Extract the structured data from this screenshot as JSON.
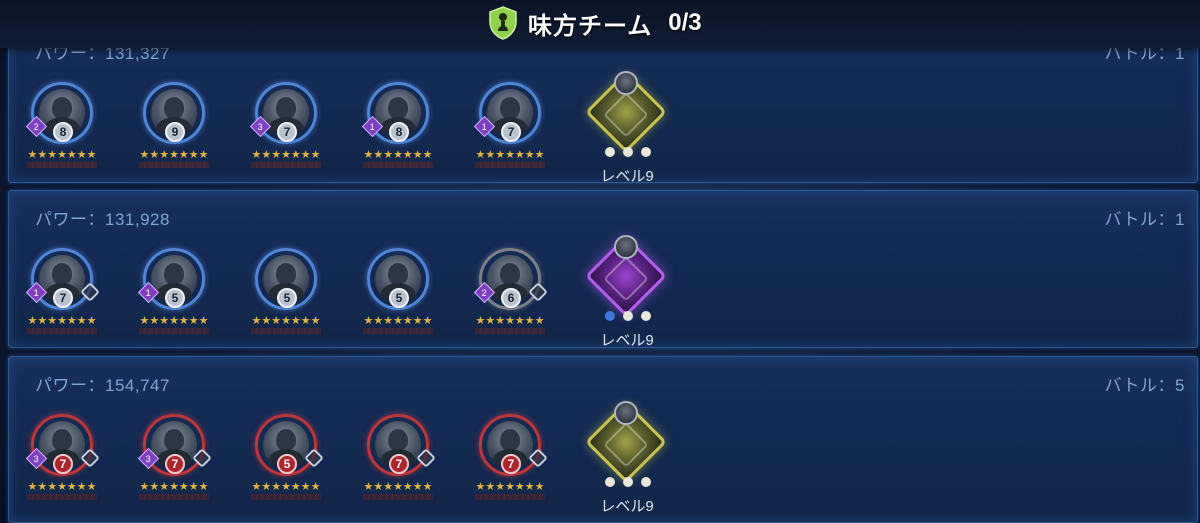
{
  "header": {
    "title": "味方チーム",
    "count": "0/3",
    "icon": "shield-person-icon",
    "icon_color": "#8fd24a"
  },
  "teams": [
    {
      "power": "パワー：131,327",
      "battle": "バトル：1",
      "characters": [
        {
          "gear": "8",
          "relic_color": "blue",
          "zeta": "2",
          "stars": "★★★★★★★"
        },
        {
          "gear": "9",
          "relic_color": "blue",
          "zeta": "",
          "stars": "★★★★★★★"
        },
        {
          "gear": "7",
          "relic_color": "blue",
          "zeta": "3",
          "stars": "★★★★★★★"
        },
        {
          "gear": "8",
          "relic_color": "blue",
          "zeta": "1",
          "stars": "★★★★★★★"
        },
        {
          "gear": "7",
          "relic_color": "blue",
          "zeta": "1",
          "stars": "★★★★★★★"
        }
      ],
      "datacron": {
        "label": "レベル9",
        "color": "gold"
      }
    },
    {
      "power": "パワー：131,928",
      "battle": "バトル：1",
      "characters": [
        {
          "gear": "7",
          "relic_color": "blue",
          "zeta": "1",
          "stars": "★★★★★★★"
        },
        {
          "gear": "5",
          "relic_color": "blue",
          "zeta": "1",
          "stars": "★★★★★★★"
        },
        {
          "gear": "5",
          "relic_color": "blue",
          "zeta": "",
          "stars": "★★★★★★★"
        },
        {
          "gear": "5",
          "relic_color": "blue",
          "zeta": "",
          "stars": "★★★★★★★"
        },
        {
          "gear": "6",
          "relic_color": "grey",
          "zeta": "2",
          "stars": "★★★★★★★"
        }
      ],
      "datacron": {
        "label": "レベル9",
        "color": "purple"
      }
    },
    {
      "power": "パワー：154,747",
      "battle": "バトル：5",
      "characters": [
        {
          "gear": "7",
          "relic_color": "red",
          "zeta": "3",
          "stars": "★★★★★★★"
        },
        {
          "gear": "7",
          "relic_color": "red",
          "zeta": "3",
          "stars": "★★★★★★★"
        },
        {
          "gear": "5",
          "relic_color": "red",
          "zeta": "",
          "stars": "★★★★★★★"
        },
        {
          "gear": "7",
          "relic_color": "red",
          "zeta": "",
          "stars": "★★★★★★★"
        },
        {
          "gear": "7",
          "relic_color": "red",
          "zeta": "",
          "stars": "★★★★★★★"
        }
      ],
      "datacron": {
        "label": "レベル9",
        "color": "gold"
      }
    }
  ]
}
